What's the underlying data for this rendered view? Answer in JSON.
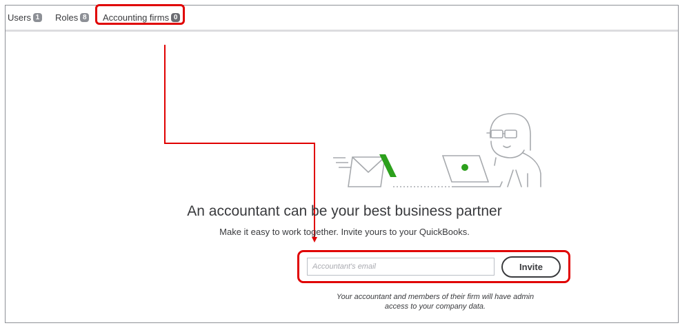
{
  "tabs": [
    {
      "label": "Users",
      "count": "1"
    },
    {
      "label": "Roles",
      "count": "8"
    },
    {
      "label": "Accounting firms",
      "count": "0"
    }
  ],
  "empty_state": {
    "heading": "An accountant can be your best business partner",
    "subheading": "Make it easy to work together. Invite yours to your QuickBooks.",
    "email_placeholder": "Accountant's email",
    "email_value": "",
    "invite_label": "Invite",
    "footnote_line1": "Your accountant and members of their firm will have admin",
    "footnote_line2": "access to your company data."
  },
  "colors": {
    "accent_green": "#2ca01c",
    "annotation_red": "#e00000",
    "text": "#393a3d",
    "badge": "#8d9096"
  },
  "icons": [
    "envelope-icon",
    "accountant-laptop-illustration",
    "arrow-down-icon"
  ]
}
